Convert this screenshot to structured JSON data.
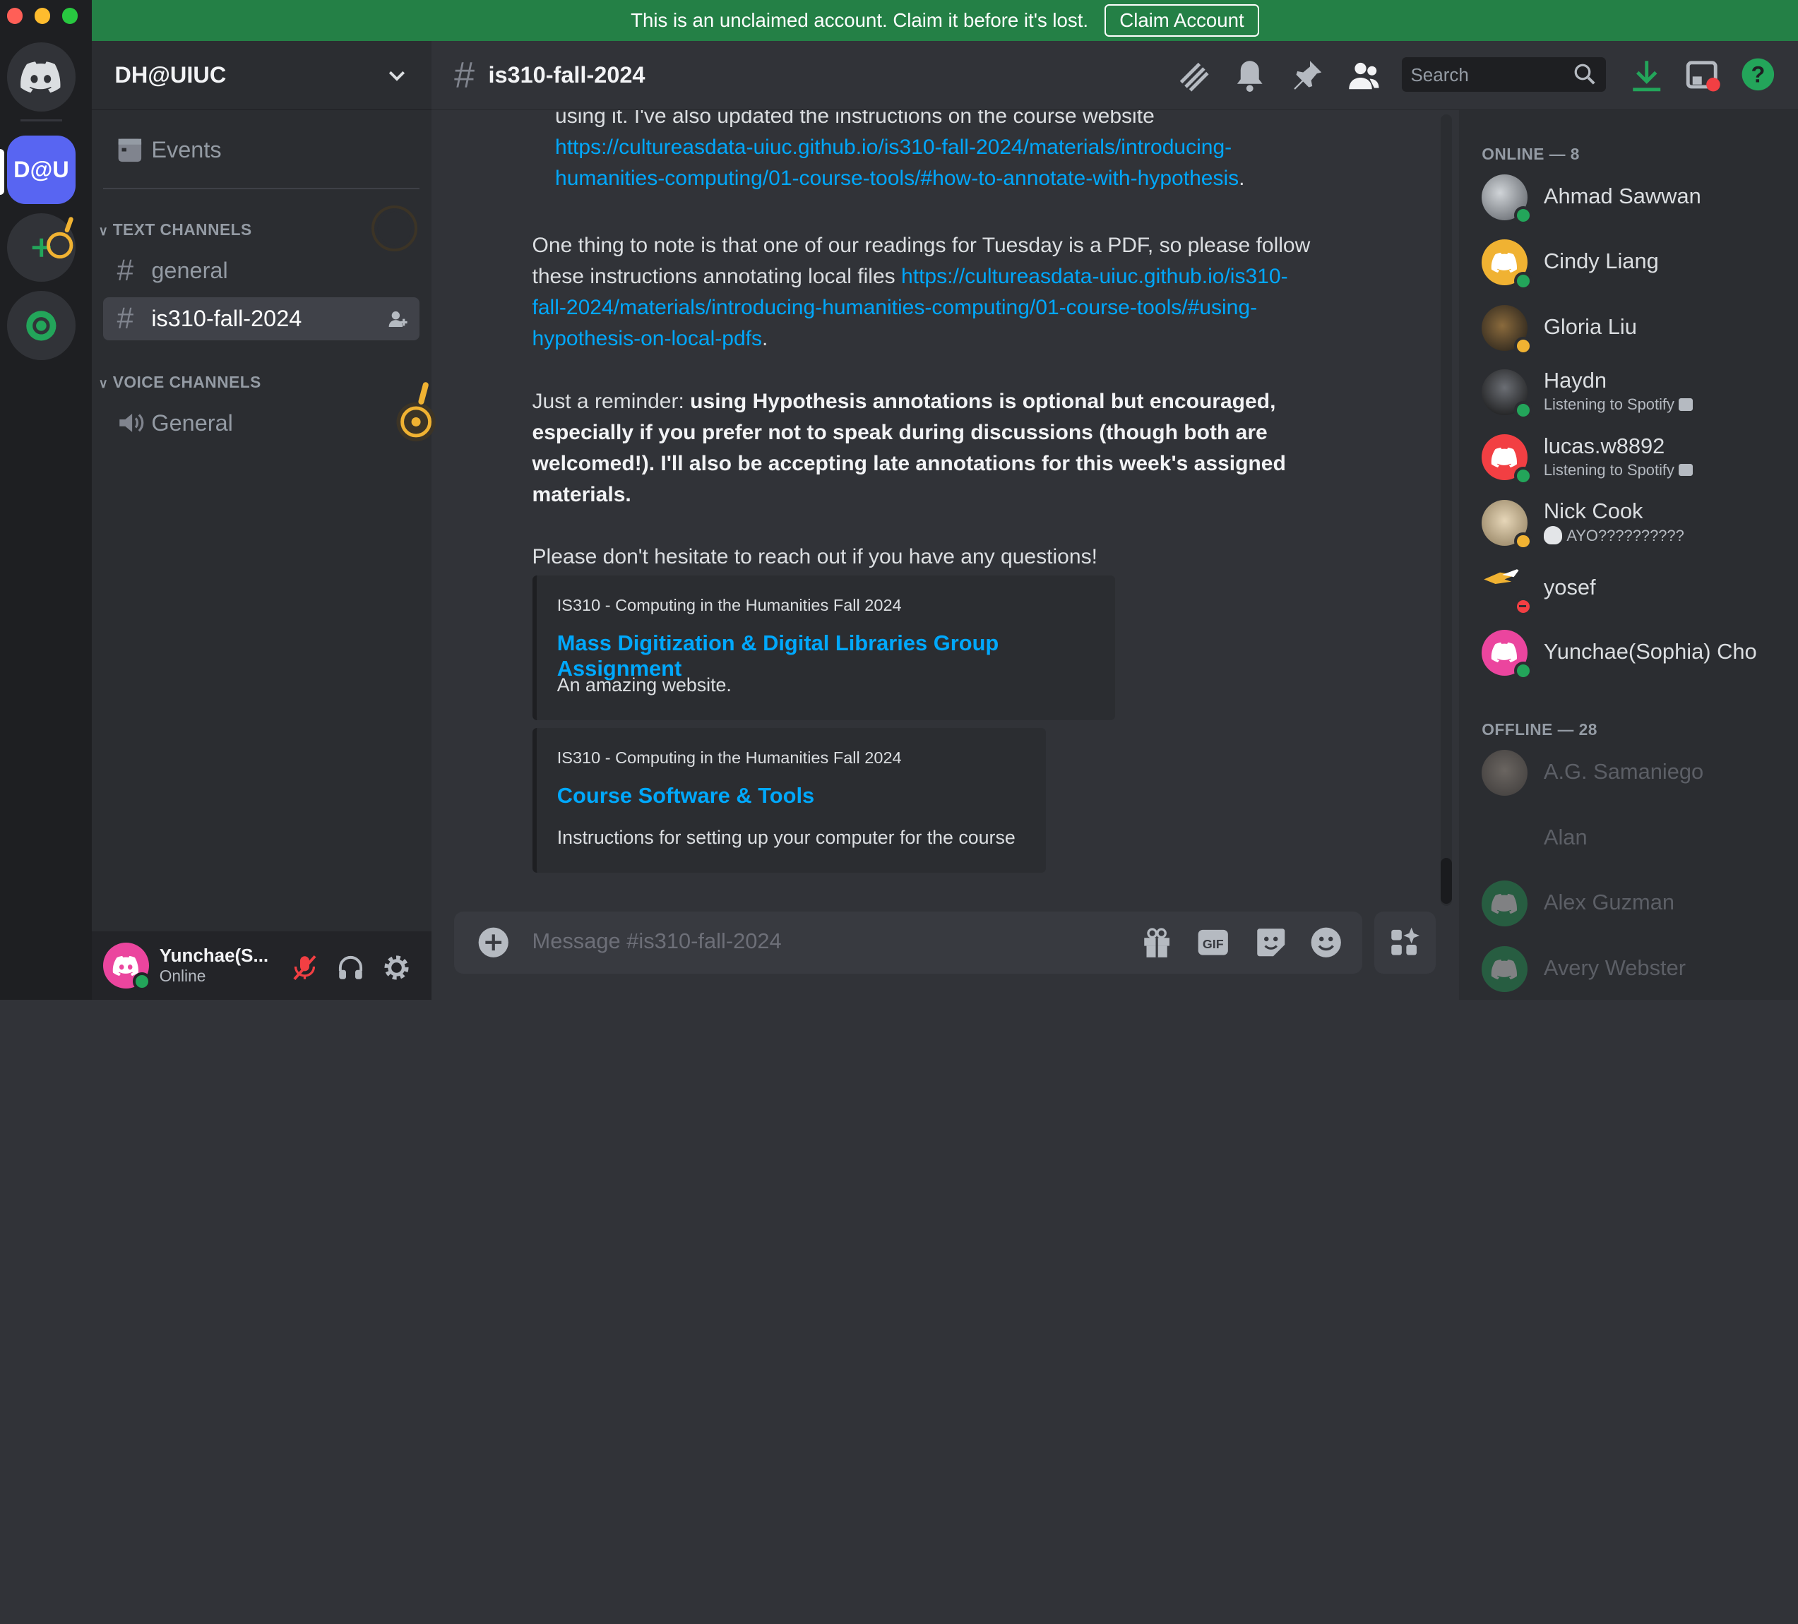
{
  "banner": {
    "text": "This is an unclaimed account. Claim it before it's lost.",
    "button": "Claim Account"
  },
  "rail": {
    "server_initials": "D@U"
  },
  "guild": {
    "name": "DH@UIUC",
    "events": "Events"
  },
  "categories": {
    "text": "TEXT CHANNELS",
    "voice": "VOICE CHANNELS"
  },
  "channels": {
    "general": "general",
    "active": "is310-fall-2024",
    "voice_general": "General"
  },
  "user": {
    "name": "Yunchae(S...",
    "status": "Online"
  },
  "header": {
    "channel": "is310-fall-2024",
    "search_placeholder": "Search"
  },
  "messages": {
    "line1": "using it. I've also updated the instructions on the course website",
    "link1a": "https://cultureasdata-uiuc.github.io/is310-fall-2024/materials/introducing-",
    "link1b": "humanities-computing/01-course-tools/#how-to-annotate-with-hypothesis",
    "p2a": "One thing to note is that one of our readings for Tuesday is a PDF, so please follow",
    "p2b": "these instructions annotating local files ",
    "link2a": "https://cultureasdata-uiuc.github.io/is310-",
    "link2b": "fall-2024/materials/introducing-humanities-computing/01-course-tools/#using-",
    "link2c": "hypothesis-on-local-pdfs",
    "p3a": "Just a reminder: ",
    "p3bold1": "using Hypothesis annotations is optional but encouraged,",
    "p3bold2": "especially if you prefer not to speak during discussions (though both are",
    "p3bold3": "welcomed!). I'll also be accepting late annotations for this week's assigned",
    "p3bold4": "materials.",
    "p4": "Please don't hesitate to reach out if you have any questions!"
  },
  "embeds": [
    {
      "provider": "IS310 - Computing in the Humanities Fall 2024",
      "title": "Mass Digitization & Digital Libraries Group Assignment",
      "description": "An amazing website."
    },
    {
      "provider": "IS310 - Computing in the Humanities Fall 2024",
      "title": "Course Software & Tools",
      "description": "Instructions for setting up your computer for the course"
    }
  ],
  "composer": {
    "placeholder": "Message #is310-fall-2024"
  },
  "members": {
    "online_header": "ONLINE — 8",
    "offline_header": "OFFLINE — 28",
    "online": [
      {
        "name": "Ahmad Sawwan",
        "sub": ""
      },
      {
        "name": "Cindy Liang",
        "sub": ""
      },
      {
        "name": "Gloria Liu",
        "sub": ""
      },
      {
        "name": "Haydn",
        "sub": "Listening to Spotify"
      },
      {
        "name": "lucas.w8892",
        "sub": "Listening to Spotify"
      },
      {
        "name": "Nick Cook",
        "sub": "AYO??????????"
      },
      {
        "name": "yosef",
        "sub": ""
      },
      {
        "name": "Yunchae(Sophia) Cho",
        "sub": ""
      }
    ],
    "offline": [
      {
        "name": "A.G. Samaniego"
      },
      {
        "name": "Alan"
      },
      {
        "name": "Alex Guzman"
      },
      {
        "name": "Avery Webster"
      }
    ]
  },
  "colors": {
    "accent": "#5865f2",
    "online": "#23a55a",
    "idle": "#f0b232",
    "dnd": "#f23f43",
    "link": "#00a8fc",
    "banner": "#248046"
  }
}
